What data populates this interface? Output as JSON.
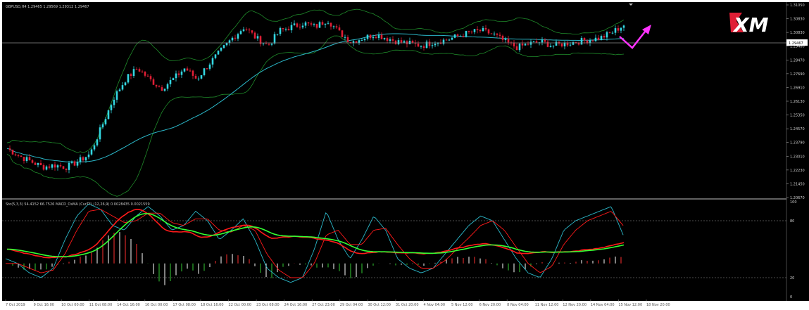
{
  "symbol_info": "GBPUSD,H4  1.29465 1.29569 1.29312 1.29467",
  "logo_text": "XM",
  "current_price": "1.29467",
  "indicator_info": "Sto(5,3,3) 54.4152 66.7526  MACD_OsMA (CurTF) (12,26,9) 0.0028435 0.0021559",
  "colors": {
    "background": "#000000",
    "bull_candle": "#33d6e0",
    "bear_candle": "#e01e35",
    "bollinger": "#1f8a2a",
    "moving_average": "#2bb7c8",
    "arrow": "#ff33ff",
    "stoch_main": "#2bb7c8",
    "stoch_signal": "#ff1a1a",
    "macd_line": "#ff1a1a",
    "signal_line": "#33ff33"
  },
  "price_axis": {
    "ticks": [
      "1.31050",
      "1.30830",
      "1.30830",
      "1.29480",
      "1.28470",
      "1.27690",
      "1.26910",
      "1.26130",
      "1.25350",
      "1.24570",
      "1.23790",
      "1.23010",
      "1.22230",
      "1.21450",
      "1.20670"
    ]
  },
  "indicator_axis": {
    "ticks": [
      "100",
      "80",
      "20",
      "0"
    ]
  },
  "time_axis": {
    "labels": [
      "7 Oct 2019",
      "9 Oct 16:00",
      "10 Oct 00:00",
      "11 Oct 08:00",
      "14 Oct 16:00",
      "16 Oct 00:00",
      "17 Oct 08:00",
      "18 Oct 16:00",
      "22 Oct 00:00",
      "23 Oct 08:00",
      "24 Oct 16:00",
      "27 Oct 23:00",
      "29 Oct 04:00",
      "30 Oct 12:00",
      "31 Oct 20:00",
      "4 Nov 04:00",
      "5 Nov 12:00",
      "6 Nov 20:00",
      "8 Nov 04:00",
      "11 Nov 12:00",
      "12 Nov 20:00",
      "14 Nov 04:00",
      "15 Nov 12:00",
      "18 Nov 20:00"
    ]
  },
  "chart_data": [
    {
      "type": "candlestick",
      "title": "GBPUSD,H4",
      "ylim": [
        1.2067,
        1.3105
      ],
      "x_labels": [
        "7 Oct 2019",
        "9 Oct 16:00",
        "10 Oct 00:00",
        "11 Oct 08:00",
        "14 Oct 16:00",
        "16 Oct 00:00",
        "17 Oct 08:00",
        "18 Oct 16:00",
        "22 Oct 00:00",
        "23 Oct 08:00",
        "24 Oct 16:00",
        "27 Oct 23:00",
        "29 Oct 04:00",
        "30 Oct 12:00",
        "31 Oct 20:00",
        "4 Nov 04:00",
        "5 Nov 12:00",
        "6 Nov 20:00",
        "8 Nov 04:00",
        "11 Nov 12:00",
        "12 Nov 20:00",
        "14 Nov 04:00",
        "15 Nov 12:00",
        "18 Nov 20:00"
      ],
      "close_path": [
        1.233,
        1.229,
        1.226,
        1.223,
        1.224,
        1.223,
        1.226,
        1.23,
        1.245,
        1.26,
        1.27,
        1.276,
        1.27,
        1.265,
        1.27,
        1.276,
        1.27,
        1.278,
        1.285,
        1.292,
        1.298,
        1.292,
        1.288,
        1.296,
        1.298,
        1.3,
        1.298,
        1.302,
        1.295,
        1.29,
        1.292,
        1.294,
        1.292,
        1.29,
        1.289,
        1.288,
        1.29,
        1.291,
        1.293,
        1.295,
        1.296,
        1.294,
        1.29,
        1.287,
        1.289,
        1.29,
        1.288,
        1.289,
        1.29,
        1.291,
        1.292,
        1.295,
        1.299
      ],
      "series": [
        {
          "name": "",
          "style": "bollinger_upper"
        },
        {
          "name": "",
          "style": "bollinger_lower"
        },
        {
          "name": "",
          "style": "moving_average"
        }
      ]
    },
    {
      "type": "line",
      "title": "Sto(5,3,3) 54.4152 66.7526",
      "ylim": [
        0,
        100
      ],
      "levels": [
        80,
        20
      ],
      "stoch_main": [
        40,
        35,
        25,
        20,
        30,
        60,
        85,
        98,
        92,
        75,
        70,
        85,
        95,
        85,
        70,
        75,
        90,
        80,
        60,
        70,
        82,
        60,
        30,
        20,
        15,
        20,
        50,
        90,
        60,
        40,
        60,
        85,
        70,
        40,
        30,
        25,
        30,
        45,
        60,
        75,
        85,
        80,
        60,
        40,
        25,
        20,
        40,
        70,
        80,
        85,
        90,
        95,
        65
      ],
      "stoch_signal": [
        35,
        35,
        30,
        25,
        28,
        45,
        70,
        90,
        92,
        85,
        78,
        80,
        88,
        88,
        78,
        75,
        82,
        82,
        70,
        68,
        75,
        70,
        45,
        28,
        20,
        20,
        35,
        65,
        70,
        55,
        55,
        70,
        72,
        55,
        40,
        30,
        30,
        38,
        50,
        62,
        75,
        80,
        70,
        52,
        35,
        25,
        32,
        55,
        70,
        80,
        85,
        90,
        75
      ]
    },
    {
      "type": "bar",
      "title": "MACD_OsMA (CurTF) (12,26,9) 0.0028435 0.0021559"
    }
  ]
}
